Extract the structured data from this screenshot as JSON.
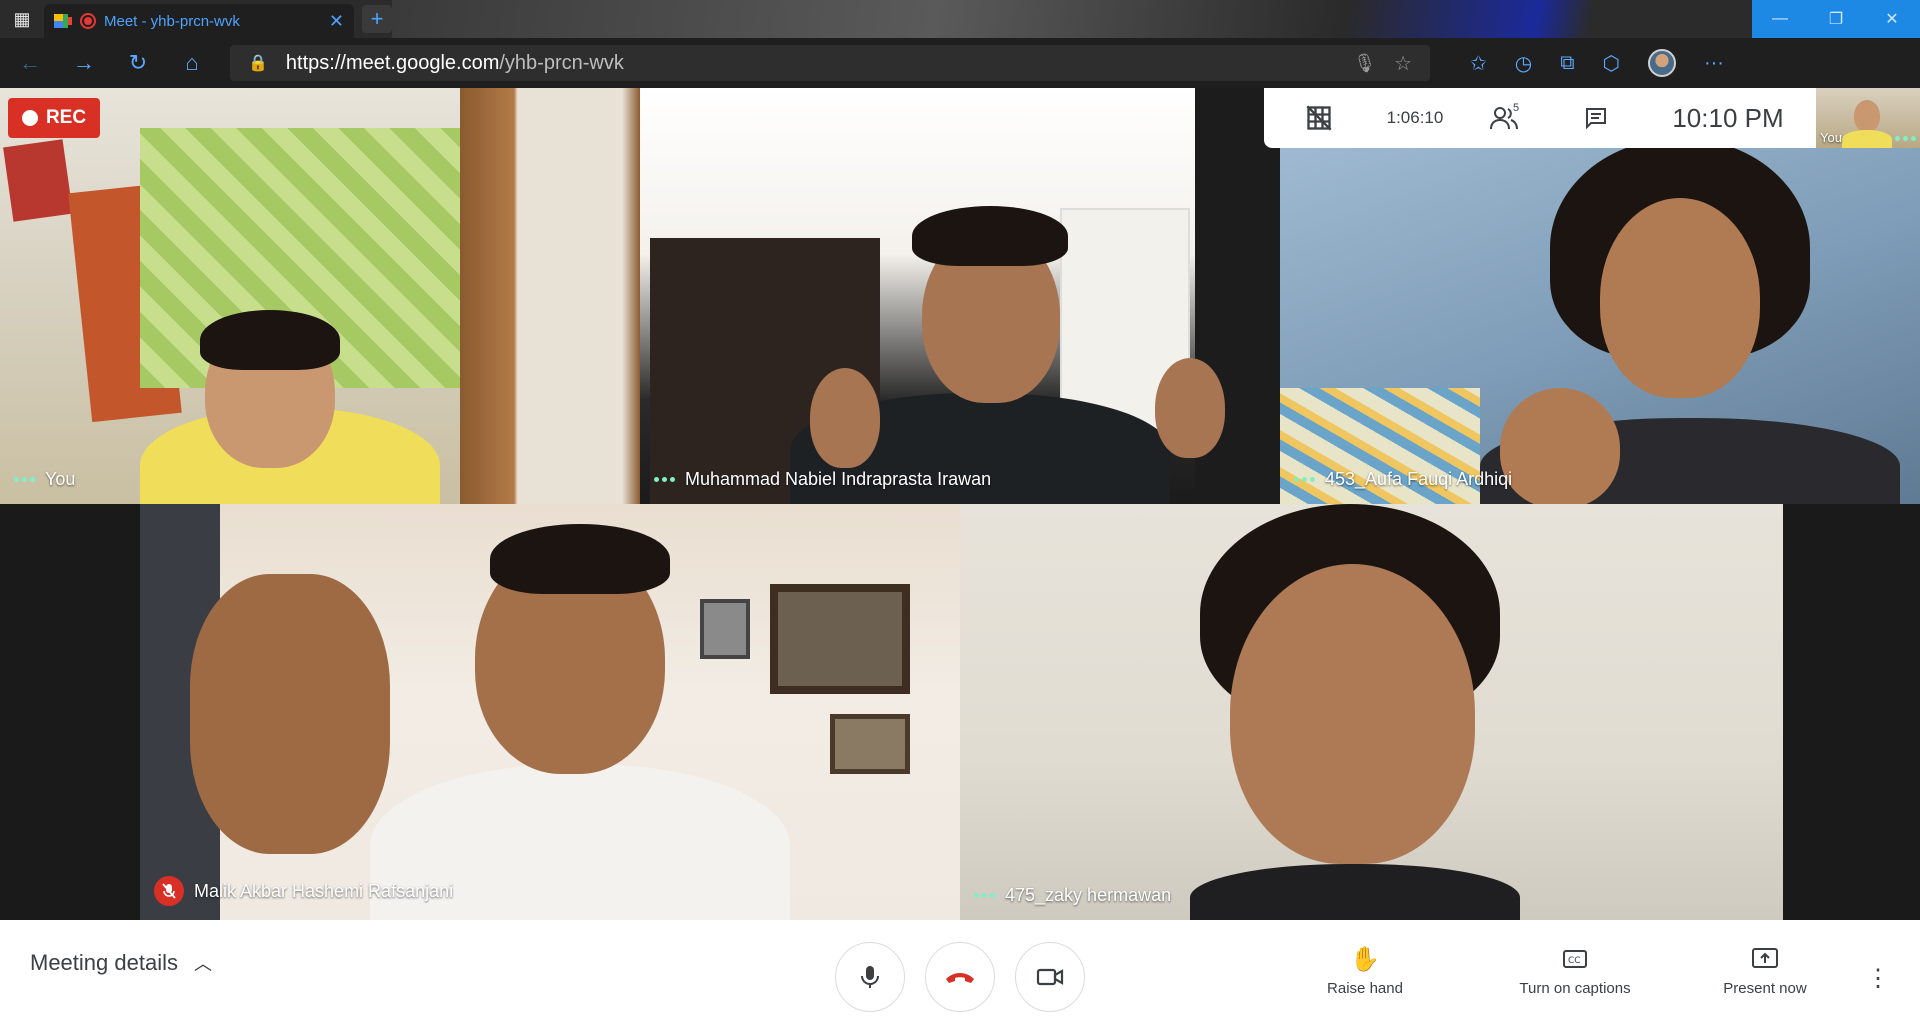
{
  "browser": {
    "tab_title": "Meet - yhb-prcn-wvk",
    "tab_close_icon": "close-icon",
    "new_tab_icon": "plus-icon",
    "url_host": "https://meet.google.com",
    "url_path": "/yhb-prcn-wvk",
    "window_controls": [
      "minimize",
      "restore",
      "close"
    ],
    "accent_color": "#5aa9ff"
  },
  "recording": {
    "label": "REC",
    "color": "#d93025"
  },
  "infobar": {
    "timer": "1:06:10",
    "participant_count": "5",
    "clock": "10:10  PM"
  },
  "self_view": {
    "name": "You"
  },
  "tiles": [
    {
      "name": "You",
      "status": "speaking-dots"
    },
    {
      "name": "Muhammad Nabiel Indraprasta Irawan",
      "status": "speaking-dots"
    },
    {
      "name": "453_Aufa Fauqi Ardhiqi",
      "status": "speaking-dots"
    },
    {
      "name": "Malik Akbar Hashemi Rafsanjani",
      "status": "muted"
    },
    {
      "name": "475_zaky hermawan",
      "status": "speaking-dots"
    }
  ],
  "bottom_bar": {
    "meeting_details": "Meeting details",
    "raise_hand": "Raise hand",
    "captions": "Turn on captions",
    "present": "Present now"
  }
}
